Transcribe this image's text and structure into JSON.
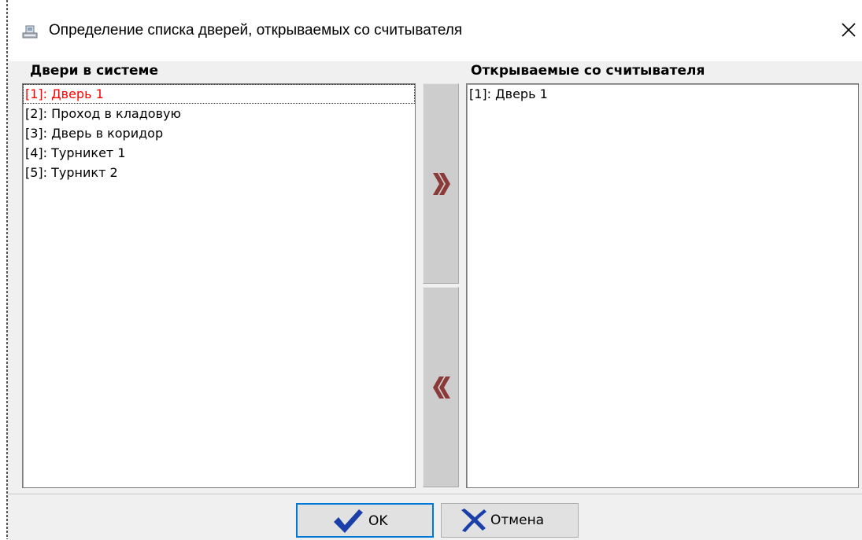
{
  "window": {
    "title": "Определение списка дверей, открываемых со считывателя",
    "icon": "app-window-icon",
    "close_icon": "close-icon"
  },
  "available": {
    "label": "Двери в системе",
    "items": [
      "[1]: Дверь 1",
      "[2]: Проход в кладовую",
      "[3]: Дверь в коридор",
      "[4]: Турникет 1",
      "[5]: Турникт 2"
    ],
    "selected_index": 0
  },
  "assigned": {
    "label": "Открываемые со считывателя",
    "items": [
      "[1]: Дверь 1"
    ]
  },
  "arrows": {
    "add_icon": "double-chevron-right-icon",
    "remove_icon": "double-chevron-left-icon",
    "color": "#8b3a3a"
  },
  "buttons": {
    "ok_label": "OK",
    "cancel_label": "Отмена",
    "ok_icon": "checkmark-icon",
    "cancel_icon": "cross-icon",
    "ok_icon_color": "#1a3fa8",
    "cancel_icon_color": "#1a3fa8"
  },
  "colors": {
    "selected_text": "#ff0000",
    "default_button_border": "#0078d7"
  }
}
